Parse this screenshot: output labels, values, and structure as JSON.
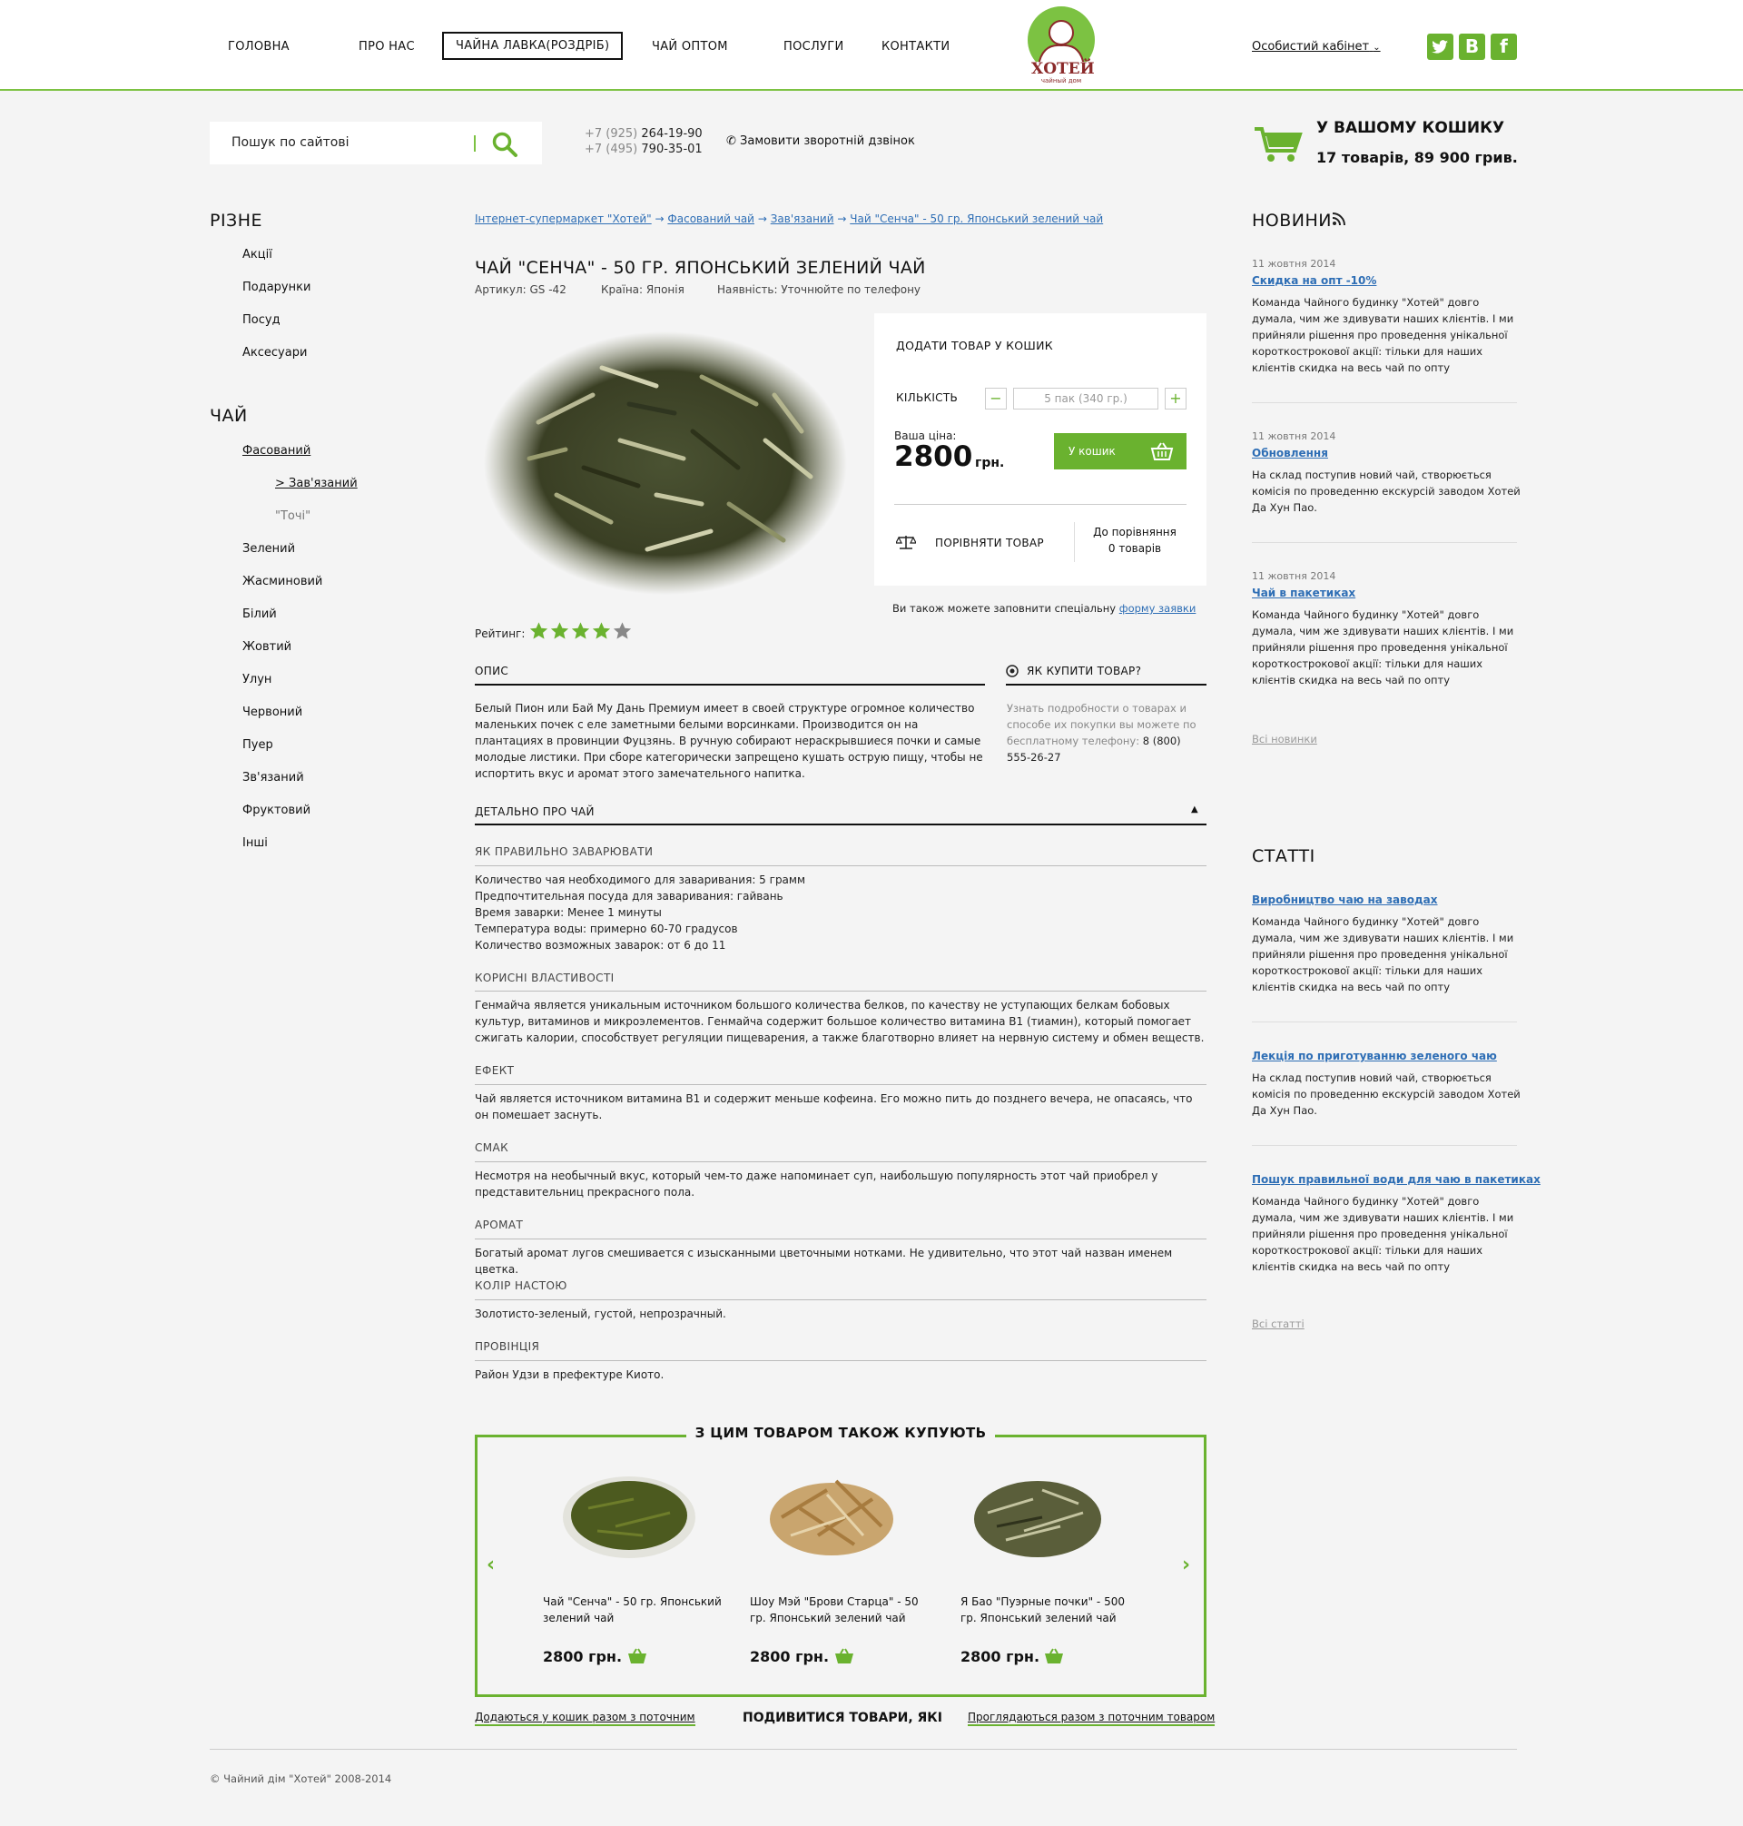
{
  "header": {
    "nav": [
      {
        "label": "ГОЛОВНА"
      },
      {
        "label": "ПРО НАС"
      },
      {
        "label": "ЧАЙНА ЛАВКА(РОЗДРІБ)"
      },
      {
        "label": "ЧАЙ ОПТОМ"
      },
      {
        "label": "ПОСЛУГИ"
      },
      {
        "label": "КОНТАКТИ"
      }
    ],
    "logo_text": "ХОТЕЙ",
    "logo_sub": "чайный дом",
    "cabinet": "Особистий кабінет",
    "social": [
      "twitter",
      "vk",
      "facebook"
    ]
  },
  "search": {
    "placeholder": "Пошук по сайтові"
  },
  "phones": [
    {
      "code": "+7 (925)",
      "number": "264-19-90"
    },
    {
      "code": "+7 (495)",
      "number": "790-35-01"
    }
  ],
  "callback": "Замовити зворотній дзвінок",
  "cart": {
    "title": "У ВАШОМУ КОШИКУ",
    "summary": "17 товарів, 89 900 грив."
  },
  "sidebar": {
    "misc_title": "РІЗНЕ",
    "misc_items": [
      "Акції",
      "Подарунки",
      "Посуд",
      "Аксесуари"
    ],
    "tea_title": "ЧАЙ",
    "tea_items": [
      "Фасований",
      "> Зав'язаний",
      "\"Точі\"",
      "Зелений",
      "Жасминовий",
      "Білий",
      "Жовтий",
      "Улун",
      "Червоний",
      "Пуер",
      "Зв'язаний",
      "Фруктовий",
      "Інші"
    ]
  },
  "breadcrumbs": [
    "Інтернет-супермаркет \"Хотей\"",
    "Фасований чай",
    "Зав'язаний",
    "Чай \"Сенча\" - 50 гр. Японський зелений чай"
  ],
  "breadcrumb_sep": "→",
  "product": {
    "title": "ЧАЙ \"СЕНЧА\" - 50 ГР. ЯПОНСЬКИЙ ЗЕЛЕНИЙ ЧАЙ",
    "article": "Артикул: GS -42",
    "country": "Країна: Японія",
    "availability": "Наявність: Уточнюйте по телефону",
    "rating_label": "Рейтинг:",
    "rating": 4,
    "rating_max": 5
  },
  "buy": {
    "heading": "ДОДАТИ ТОВАР У КОШИК",
    "qty_label": "КІЛЬКІСТЬ",
    "qty_value": "5 пак (340 гр.)",
    "minus": "−",
    "plus": "+",
    "price_label": "Ваша ціна:",
    "price": "2800",
    "currency": "грн.",
    "cart_button": "У кошик",
    "compare": "ПОРІВНЯТИ ТОВАР",
    "compare_count_1": "До порівняння",
    "compare_count_2": "0 товарів",
    "request_text": "Ви також можете заповнити спеціальну",
    "request_link": "форму заявки"
  },
  "description": {
    "title": "ОПИС",
    "text": "Белый Пион или Бай Му Дань Премиум имеет в своей структуре огромное количество маленьких почек с еле заметными белыми ворсинками. Производится он на плантациях в провинции Фуцзянь. В ручную собирают нераскрывшиеся почки и самые молодые листики. При сборе категорически запрещено кушать острую пищу, чтобы не испортить вкус и аромат этого замечательного напитка."
  },
  "howto": {
    "title": "ЯК КУПИТИ ТОВАР?",
    "text": "Узнать подробности о товарах и способе их покупки вы можете по бесплатному телефону:",
    "phone": "8 (800) 555-26-27"
  },
  "details": {
    "title": "ДЕТАЛЬНО ПРО ЧАЙ",
    "sections": [
      {
        "title": "ЯК ПРАВИЛЬНО ЗАВАРЮВАТИ",
        "lines": [
          "Количество чая необходимого для заваривания: 5 грамм",
          "Предпочтительная посуда для заваривания: гайвань",
          "Время заварки: Менее 1 минуты",
          "Температура воды: примерно 60-70 градусов",
          "Количество возможных заварок: от 6 до 11"
        ]
      },
      {
        "title": "КОРИСНІ ВЛАСТИВОСТІ",
        "lines": [
          "Генмайча является уникальным источником большого количества белков, по качеству не уступающих белкам бобовых культур, витаминов и микроэлементов. Генмайча содержит большое количество витамина В1 (тиамин), который помогает сжигать калории, способствует регуляции пищеварения, а также благотворно влияет на нервную систему и обмен веществ."
        ]
      },
      {
        "title": "ЕФЕКТ",
        "lines": [
          "Чай является источником витамина В1 и содержит меньше кофеина. Его можно пить до позднего вечера, не опасаясь, что он помешает заснуть."
        ]
      },
      {
        "title": "СМАК",
        "lines": [
          "Несмотря на необычный вкус, который чем-то даже напоминает суп, наибольшую популярность этот чай приобрел у представительниц прекрасного пола."
        ]
      },
      {
        "title": "АРОМАТ",
        "lines": [
          "Богатый аромат лугов смешивается с изысканными цветочными нотками. Не удивительно, что этот чай назван именем цветка."
        ]
      },
      {
        "title": "КОЛІР НАСТОЮ",
        "lines": [
          "Золотисто-зеленый, густой, непрозрачный."
        ]
      },
      {
        "title": "ПРОВІНЦІЯ",
        "lines": [
          "Район Удзи в префектуре Киото."
        ]
      }
    ]
  },
  "related": {
    "title": "З ЦИМ ТОВАРОМ ТАКОЖ КУПУЮТЬ",
    "items": [
      {
        "name": "Чай \"Сенча\" - 50 гр. Японський зелений чай",
        "price": "2800 грн."
      },
      {
        "name": "Шоу Мэй \"Брови Старца\" - 50 гр. Японський зелений чай",
        "price": "2800 грн."
      },
      {
        "name": "Я Бао \"Пуэрные почки\" - 500 гр. Японський зелений чай",
        "price": "2800 грн."
      }
    ],
    "tab_left": "Додаються у кошик разом з поточним",
    "tab_center": "ПОДИВИТИСЯ ТОВАРИ, ЯКІ",
    "tab_right": "Проглядаються разом з поточним товаром"
  },
  "news": {
    "title": "НОВИНИ",
    "items": [
      {
        "date": "11 жовтня 2014",
        "title": "Скидка на опт -10%",
        "text": "Команда Чайного будинку \"Хотей\" довго думала, чим же здивувати наших клієнтів. І ми прийняли рішення про проведення унікальної короткострокової акції: тільки для наших клієнтів скидка на весь чай по опту"
      },
      {
        "date": "11 жовтня 2014",
        "title": "Обновлення",
        "text": "На склад поступив новий чай, створюється комісія по проведенню екскурсій заводом Хотей Да Хун Пао."
      },
      {
        "date": "11 жовтня 2014",
        "title": "Чай в пакетиках",
        "text": "Команда Чайного будинку \"Хотей\" довго думала, чим же здивувати наших клієнтів. І ми прийняли рішення про проведення унікальної короткострокової акції: тільки для наших клієнтів скидка на весь чай по опту"
      }
    ],
    "all": "Всі новинки"
  },
  "articles": {
    "title": "СТАТТІ",
    "items": [
      {
        "title": "Виробництво чаю на заводах",
        "text": "Команда Чайного будинку \"Хотей\" довго думала, чим же здивувати наших клієнтів. І ми прийняли рішення про проведення унікальної короткострокової акції: тільки для наших клієнтів скидка на весь чай по опту"
      },
      {
        "title": "Лекція по приготуванню зеленого чаю",
        "text": "На склад поступив новий чай, створюється комісія по проведенню екскурсій заводом Хотей Да Хун Пао."
      },
      {
        "title": "Пошук правильної води для чаю в пакетиках",
        "text": "Команда Чайного будинку \"Хотей\" довго думала, чим же здивувати наших клієнтів. І ми прийняли рішення про проведення унікальної короткострокової акції: тільки для наших клієнтів скидка на весь чай по опту"
      }
    ],
    "all": "Всі статті"
  },
  "footer": {
    "copyright": "© Чайний дім \"Хотей\" 2008-2014"
  },
  "colors": {
    "accent": "#6ab22f",
    "link": "#2e6eb5",
    "star_off": "#888888"
  }
}
